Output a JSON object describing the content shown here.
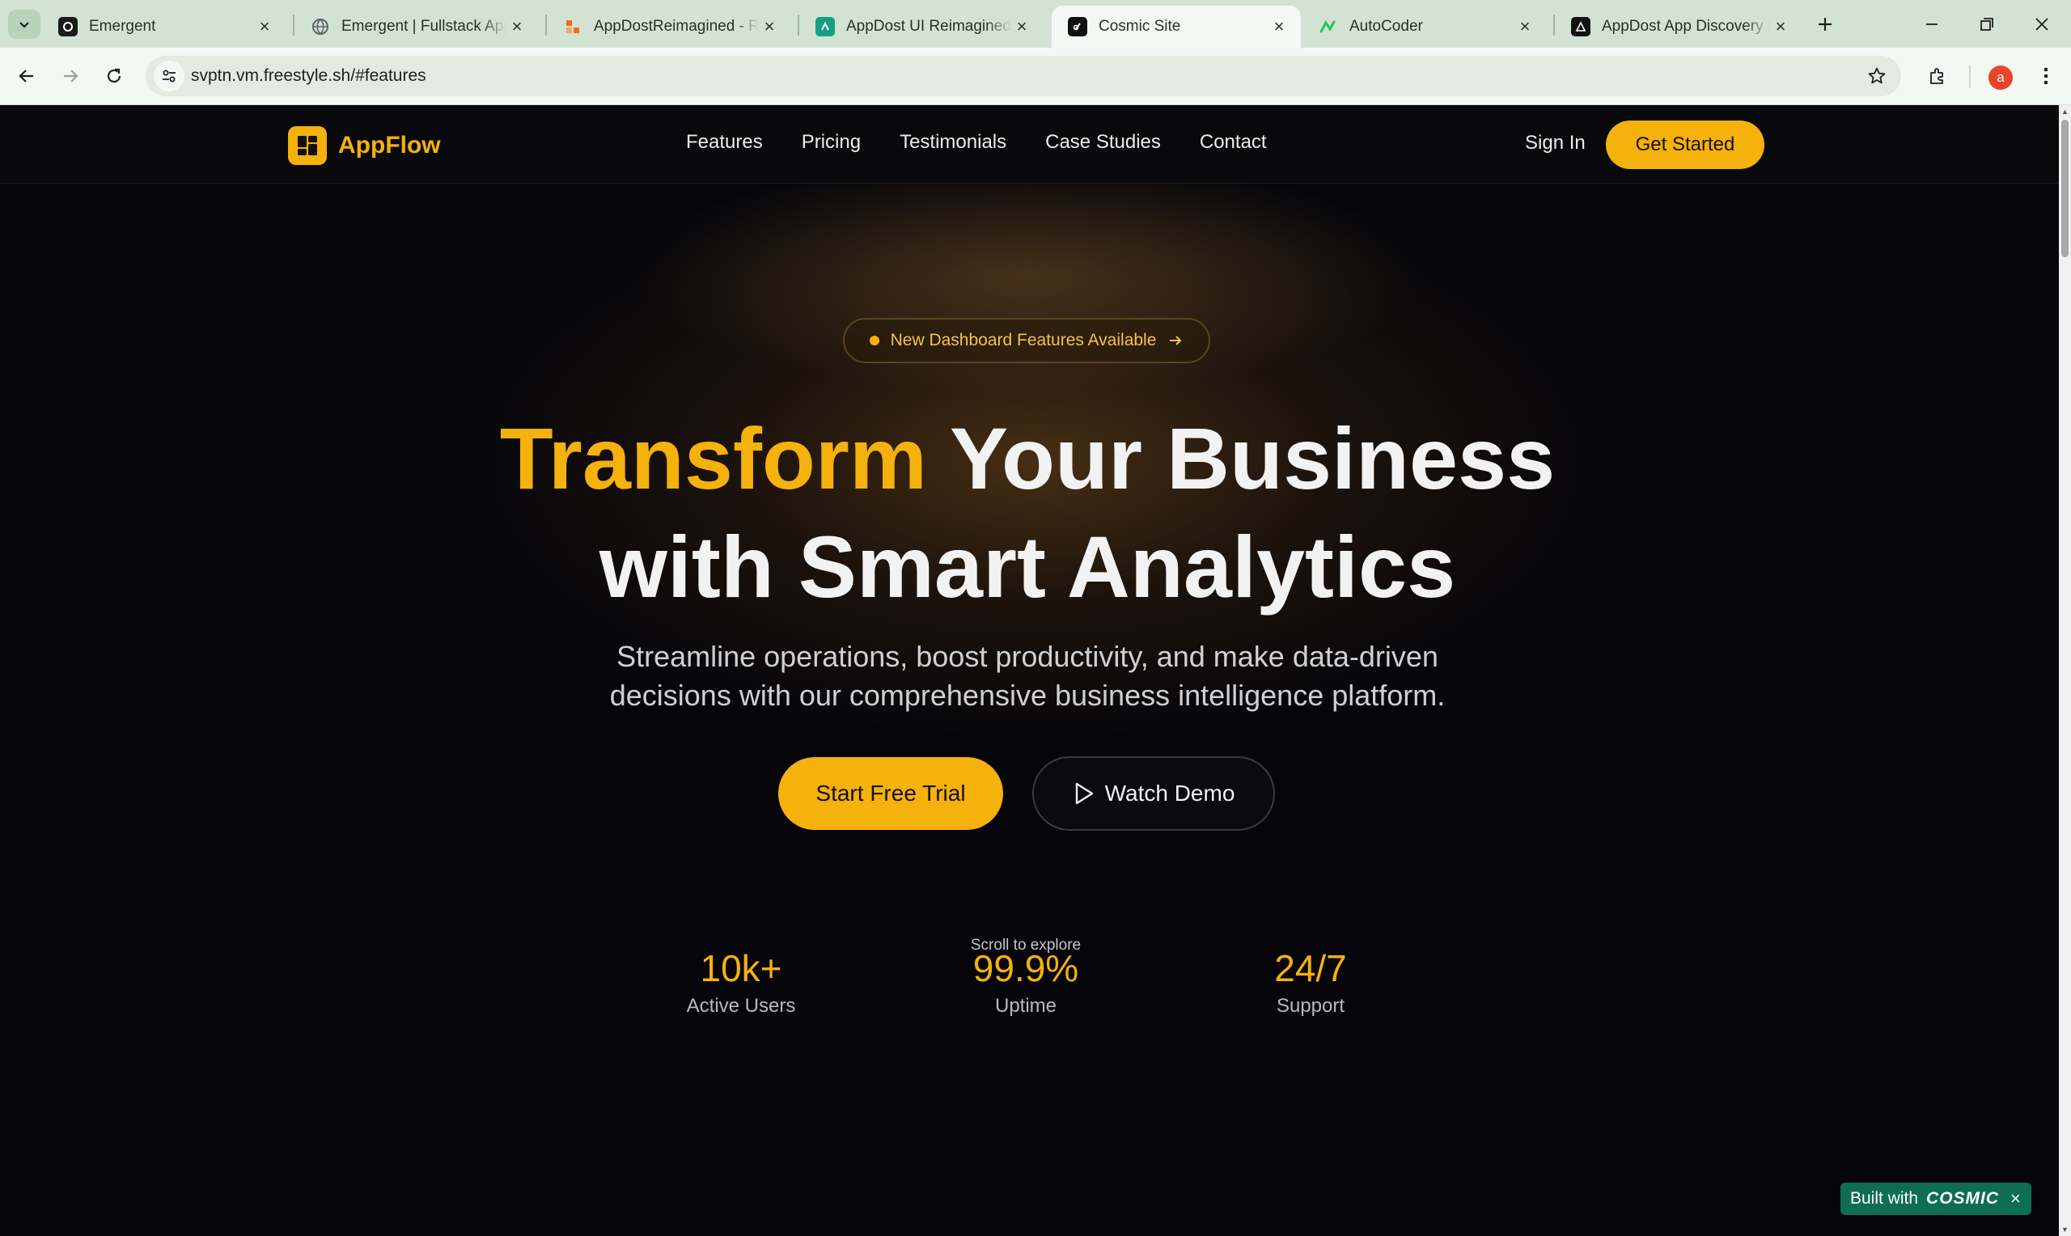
{
  "browser": {
    "tabs": [
      {
        "title": "Emergent",
        "favicon_color": "#1a1a1a",
        "icon": "emergent-favicon-icon"
      },
      {
        "title": "Emergent | Fullstack App",
        "favicon_color": "#5f6368",
        "icon": "globe-icon"
      },
      {
        "title": "AppDostReimagined - Re",
        "favicon_color": "#f26b1d",
        "icon": "appdost-favicon-icon"
      },
      {
        "title": "AppDost UI Reimagined",
        "favicon_color": "#14a085",
        "icon": "appdost-ui-favicon-icon"
      },
      {
        "title": "Cosmic Site",
        "favicon_color": "#111111",
        "icon": "cosmic-favicon-icon"
      },
      {
        "title": "AutoCoder",
        "favicon_color": "#22c55e",
        "icon": "autocoder-favicon-icon"
      },
      {
        "title": "AppDost App Discovery L",
        "favicon_color": "#111111",
        "icon": "appdost-discovery-favicon-icon"
      }
    ],
    "active_tab": 4,
    "url": "svptn.vm.freestyle.sh/#features",
    "profile_initial": "a"
  },
  "site": {
    "logo_text": "AppFlow",
    "nav": [
      "Features",
      "Pricing",
      "Testimonials",
      "Case Studies",
      "Contact"
    ],
    "sign_in": "Sign In",
    "get_started": "Get Started",
    "badge": "New Dashboard Features Available",
    "headline": {
      "highlight": "Transform",
      "line1_rest": " Your Business",
      "line2": "with Smart Analytics"
    },
    "subhead_line1": "Streamline operations, boost productivity, and make data-driven",
    "subhead_line2": "decisions with our comprehensive business intelligence platform.",
    "cta_primary": "Start Free Trial",
    "cta_secondary": "Watch Demo",
    "scroll_hint": "Scroll to explore",
    "stats": [
      {
        "value": "10k+",
        "label": "Active Users"
      },
      {
        "value": "99.9%",
        "label": "Uptime"
      },
      {
        "value": "24/7",
        "label": "Support"
      }
    ],
    "built_with": {
      "text": "Built with",
      "brand": "COSMIC"
    }
  },
  "colors": {
    "accent": "#f5b10c",
    "background": "#06060a",
    "builtwith_bg": "#0e6e55"
  }
}
